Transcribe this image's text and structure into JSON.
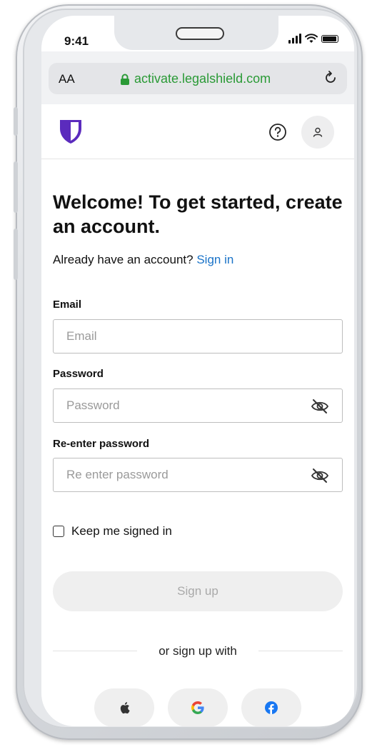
{
  "status_bar": {
    "time": "9:41"
  },
  "browser": {
    "text_size_label": "AA",
    "url": "activate.legalshield.com"
  },
  "header": {
    "logo": "shield-logo",
    "help_icon": "question-circle-icon",
    "account_icon": "user-icon"
  },
  "form": {
    "title": "Welcome! To get started, create an account.",
    "subtitle_prefix": "Already have an account?",
    "sign_in_link": "Sign in",
    "email_label": "Email",
    "email_placeholder": "Email",
    "email_value": "",
    "password_label": "Password",
    "password_placeholder": "Password",
    "password_value": "",
    "reenter_label": "Re-enter password",
    "reenter_placeholder": "Re enter password",
    "reenter_value": "",
    "keep_signed_in": "Keep me signed in",
    "keep_signed_in_checked": false,
    "signup_button": "Sign up",
    "divider_text": "or sign up with",
    "social": [
      "apple-icon",
      "google-icon",
      "facebook-icon"
    ]
  },
  "colors": {
    "brand_purple": "#5b2bbd",
    "link_blue": "#1a73c8",
    "url_green": "#2a9a36",
    "facebook_blue": "#1877f2"
  }
}
